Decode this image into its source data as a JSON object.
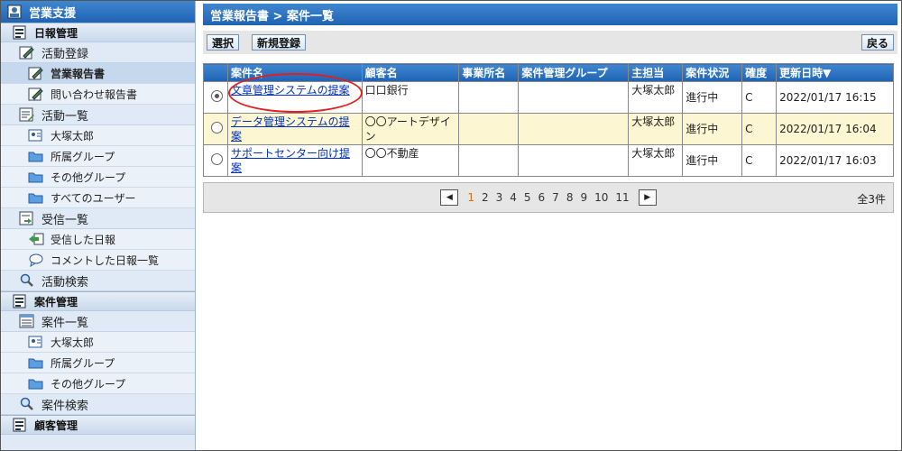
{
  "sidebar": {
    "top_title": "営業支援",
    "sections": [
      {
        "title": "日報管理",
        "items": [
          {
            "label": "活動登録",
            "icon": "edit-icon",
            "level": "item",
            "active": false
          },
          {
            "label": "営業報告書",
            "icon": "edit-icon",
            "level": "sub",
            "active": true
          },
          {
            "label": "問い合わせ報告書",
            "icon": "edit-icon",
            "level": "sub",
            "active": false
          },
          {
            "label": "活動一覧",
            "icon": "list-edit-icon",
            "level": "item",
            "active": false
          },
          {
            "label": "大塚太郎",
            "icon": "user-card-icon",
            "level": "sub",
            "active": false
          },
          {
            "label": "所属グループ",
            "icon": "folder-icon",
            "level": "sub",
            "active": false
          },
          {
            "label": "その他グループ",
            "icon": "folder-icon",
            "level": "sub",
            "active": false
          },
          {
            "label": "すべてのユーザー",
            "icon": "folder-icon",
            "level": "sub",
            "active": false
          },
          {
            "label": "受信一覧",
            "icon": "inbox-icon",
            "level": "item",
            "active": false
          },
          {
            "label": "受信した日報",
            "icon": "receive-arrow-icon",
            "level": "sub",
            "active": false
          },
          {
            "label": "コメントした日報一覧",
            "icon": "comment-icon",
            "level": "sub",
            "active": false
          },
          {
            "label": "活動検索",
            "icon": "search-icon",
            "level": "item",
            "active": false
          }
        ]
      },
      {
        "title": "案件管理",
        "items": [
          {
            "label": "案件一覧",
            "icon": "list-icon",
            "level": "item",
            "active": false
          },
          {
            "label": "大塚太郎",
            "icon": "user-card-icon",
            "level": "sub",
            "active": false
          },
          {
            "label": "所属グループ",
            "icon": "folder-icon",
            "level": "sub",
            "active": false
          },
          {
            "label": "その他グループ",
            "icon": "folder-icon",
            "level": "sub",
            "active": false
          },
          {
            "label": "案件検索",
            "icon": "search-icon",
            "level": "item",
            "active": false
          }
        ]
      },
      {
        "title": "顧客管理",
        "items": []
      }
    ]
  },
  "main": {
    "title": "営業報告書 > 案件一覧",
    "toolbar": {
      "select_label": "選択",
      "new_label": "新規登録",
      "back_label": "戻る"
    },
    "table": {
      "headers": [
        "",
        "案件名",
        "顧客名",
        "事業所名",
        "案件管理グループ",
        "主担当",
        "案件状況",
        "確度",
        "更新日時▼"
      ],
      "rows": [
        {
          "selected": true,
          "highlight": false,
          "name": "文章管理システムの提案",
          "customer": "口口銀行",
          "office": "",
          "group": "",
          "owner": "大塚太郎",
          "status": "進行中",
          "certainty": "C",
          "updated": "2022/01/17 16:15"
        },
        {
          "selected": false,
          "highlight": true,
          "name": "データ管理システムの提案",
          "customer": "〇〇アートデザイン",
          "office": "",
          "group": "",
          "owner": "大塚太郎",
          "status": "進行中",
          "certainty": "C",
          "updated": "2022/01/17 16:04"
        },
        {
          "selected": false,
          "highlight": false,
          "name": "サポートセンター向け提案",
          "customer": "〇〇不動産",
          "office": "",
          "group": "",
          "owner": "大塚太郎",
          "status": "進行中",
          "certainty": "C",
          "updated": "2022/01/17 16:03"
        }
      ]
    },
    "pager": {
      "prev_icon": "chevron-left-icon",
      "next_icon": "chevron-right-icon",
      "pages": [
        "1",
        "2",
        "3",
        "4",
        "5",
        "6",
        "7",
        "8",
        "9",
        "10",
        "11"
      ],
      "current": "1",
      "total": "全3件"
    }
  },
  "colors": {
    "accent": "#1f63b3",
    "highlight_row": "#fdf6d2",
    "current_page": "#e06a10",
    "annotation": "#e02020"
  }
}
